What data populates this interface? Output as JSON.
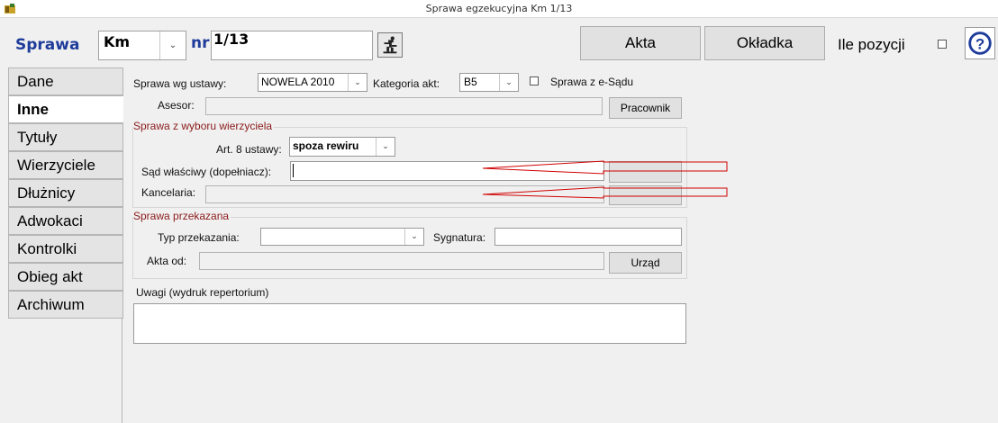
{
  "window": {
    "title": "Sprawa egzekucyjna  Km 1/13"
  },
  "toolbar": {
    "sprawa_label": "Sprawa",
    "repertorium_value": "Km",
    "nr_label": "nr",
    "nr_value": "1/13",
    "akta_label": "Akta",
    "okladka_label": "Okładka",
    "ile_pozycji_label": "Ile pozycji"
  },
  "tabs": [
    {
      "label": "Dane",
      "active": false
    },
    {
      "label": "Inne",
      "active": true
    },
    {
      "label": "Tytuły",
      "active": false
    },
    {
      "label": "Wierzyciele",
      "active": false
    },
    {
      "label": "Dłużnicy",
      "active": false
    },
    {
      "label": "Adwokaci",
      "active": false
    },
    {
      "label": "Kontrolki",
      "active": false
    },
    {
      "label": "Obieg akt",
      "active": false
    },
    {
      "label": "Archiwum",
      "active": false
    }
  ],
  "form": {
    "sprawa_wg_ustawy_label": "Sprawa wg ustawy:",
    "sprawa_wg_ustawy_value": "NOWELA 2010",
    "kategoria_akt_label": "Kategoria akt:",
    "kategoria_akt_value": "B5",
    "e_sad_label": "Sprawa z e-Sądu",
    "asesor_label": "Asesor:",
    "asesor_value": "",
    "pracownik_button": "Pracownik",
    "wybor_group_label": "Sprawa z wyboru wierzyciela",
    "art8_label": "Art. 8 ustawy:",
    "art8_value": "spoza rewiru",
    "sad_wlasciwy_label": "Sąd właściwy (dopełniacz):",
    "sad_wlasciwy_value": "",
    "kancelaria_label": "Kancelaria:",
    "kancelaria_value": "",
    "przekazana_group_label": "Sprawa przekazana",
    "typ_przekazania_label": "Typ przekazania:",
    "typ_przekazania_value": "",
    "sygnatura_label": "Sygnatura:",
    "sygnatura_value": "",
    "akta_od_label": "Akta od:",
    "akta_od_value": "",
    "urzad_button": "Urząd",
    "uwagi_label": "Uwagi (wydruk repertorium)",
    "uwagi_value": ""
  },
  "colors": {
    "accent_blue": "#1f3c9b",
    "group_label": "#8b1a1a",
    "annotation_arrow": "#d00000"
  }
}
